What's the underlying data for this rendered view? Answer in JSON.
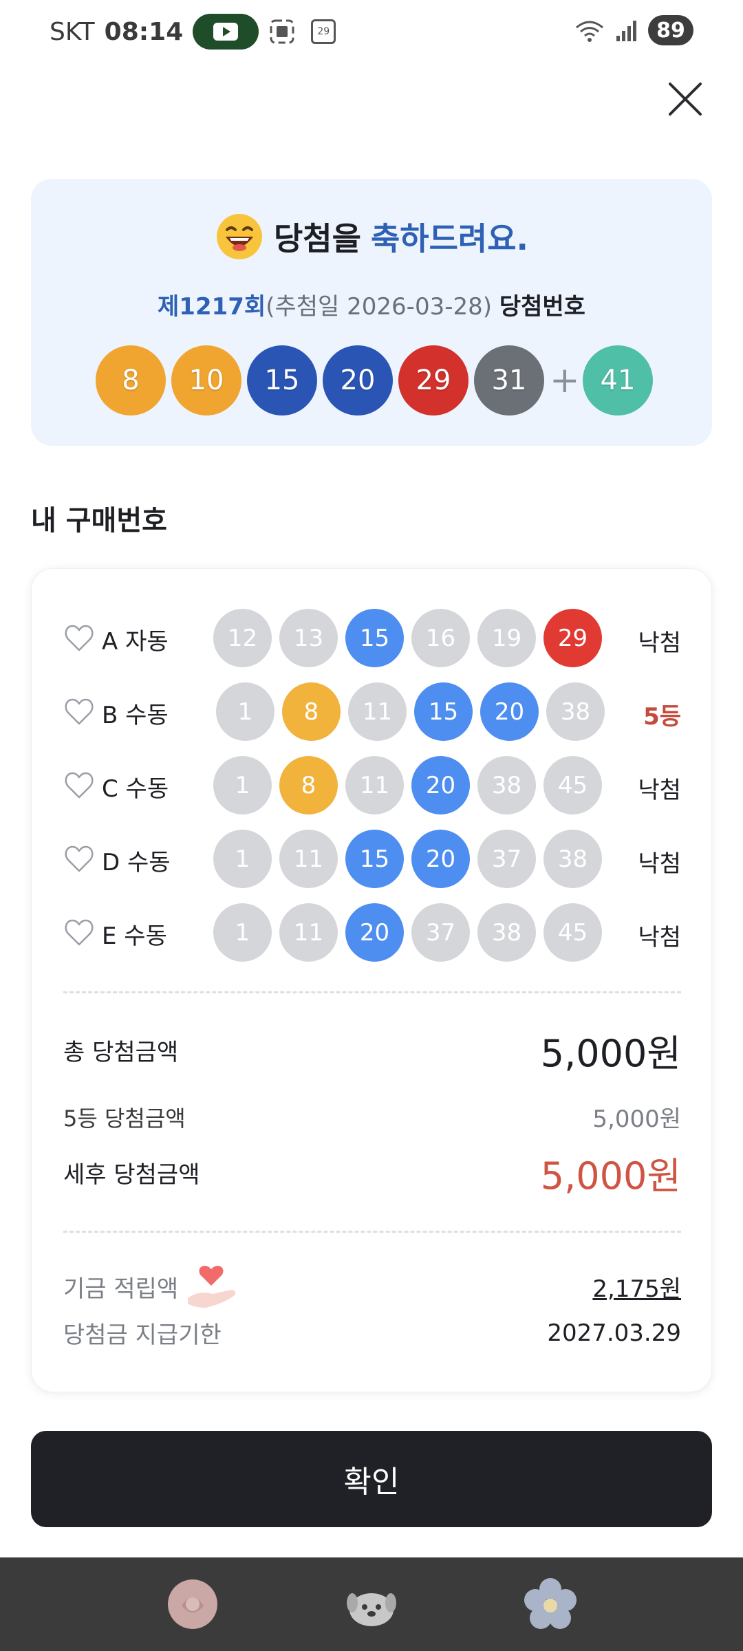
{
  "status_bar": {
    "carrier": "SKT",
    "time": "08:14",
    "battery": "89",
    "calendar_day": "29"
  },
  "header": {
    "close_icon": "close-icon"
  },
  "win_card": {
    "title_prefix": "당첨을",
    "title_highlight": "축하드려요.",
    "round": "제1217회",
    "draw_date": "(추첨일 2026-03-28)",
    "sub_tail": "당첨번호",
    "balls": [
      {
        "n": "8",
        "color": "#f0a531"
      },
      {
        "n": "10",
        "color": "#f0a531"
      },
      {
        "n": "15",
        "color": "#2a55b4"
      },
      {
        "n": "20",
        "color": "#2a55b4"
      },
      {
        "n": "29",
        "color": "#d2312c"
      },
      {
        "n": "31",
        "color": "#6b6f76"
      }
    ],
    "plus": "+",
    "bonus": {
      "n": "41",
      "color": "#4fbfa8"
    }
  },
  "section_title": "내 구매번호",
  "tickets": [
    {
      "label": "A 자동",
      "result": "낙첨",
      "is_win": false,
      "balls": [
        {
          "n": "12",
          "color": "#d4d6da"
        },
        {
          "n": "13",
          "color": "#d4d6da"
        },
        {
          "n": "15",
          "color": "#4e8ef0"
        },
        {
          "n": "16",
          "color": "#d4d6da"
        },
        {
          "n": "19",
          "color": "#d4d6da"
        },
        {
          "n": "29",
          "color": "#e03a33"
        }
      ]
    },
    {
      "label": "B 수동",
      "result": "5등",
      "is_win": true,
      "balls": [
        {
          "n": "1",
          "color": "#d4d6da"
        },
        {
          "n": "8",
          "color": "#f2b33d"
        },
        {
          "n": "11",
          "color": "#d4d6da"
        },
        {
          "n": "15",
          "color": "#4e8ef0"
        },
        {
          "n": "20",
          "color": "#4e8ef0"
        },
        {
          "n": "38",
          "color": "#d4d6da"
        }
      ]
    },
    {
      "label": "C 수동",
      "result": "낙첨",
      "is_win": false,
      "balls": [
        {
          "n": "1",
          "color": "#d4d6da"
        },
        {
          "n": "8",
          "color": "#f2b33d"
        },
        {
          "n": "11",
          "color": "#d4d6da"
        },
        {
          "n": "20",
          "color": "#4e8ef0"
        },
        {
          "n": "38",
          "color": "#d4d6da"
        },
        {
          "n": "45",
          "color": "#d4d6da"
        }
      ]
    },
    {
      "label": "D 수동",
      "result": "낙첨",
      "is_win": false,
      "balls": [
        {
          "n": "1",
          "color": "#d4d6da"
        },
        {
          "n": "11",
          "color": "#d4d6da"
        },
        {
          "n": "15",
          "color": "#4e8ef0"
        },
        {
          "n": "20",
          "color": "#4e8ef0"
        },
        {
          "n": "37",
          "color": "#d4d6da"
        },
        {
          "n": "38",
          "color": "#d4d6da"
        }
      ]
    },
    {
      "label": "E 수동",
      "result": "낙첨",
      "is_win": false,
      "balls": [
        {
          "n": "1",
          "color": "#d4d6da"
        },
        {
          "n": "11",
          "color": "#d4d6da"
        },
        {
          "n": "20",
          "color": "#4e8ef0"
        },
        {
          "n": "37",
          "color": "#d4d6da"
        },
        {
          "n": "38",
          "color": "#d4d6da"
        },
        {
          "n": "45",
          "color": "#d4d6da"
        }
      ]
    }
  ],
  "amounts": {
    "total_label": "총 당첨금액",
    "total_value": "5,000원",
    "fifth_label": "5등 당첨금액",
    "fifth_value": "5,000원",
    "after_tax_label": "세후 당첨금액",
    "after_tax_value": "5,000원"
  },
  "fund": {
    "label": "기금 적립액",
    "value": "2,175원",
    "deadline_label": "당첨금 지급기한",
    "deadline_value": "2027.03.29"
  },
  "confirm_label": "확인",
  "bottom_nav": [
    "flower-rose-icon",
    "puppy-icon",
    "flower-blossom-icon"
  ]
}
